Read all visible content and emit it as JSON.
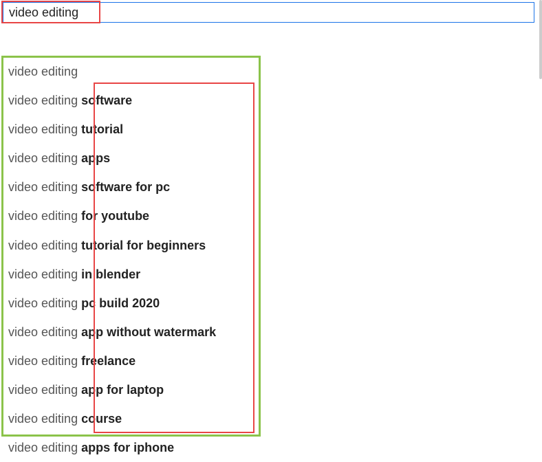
{
  "search": {
    "value": "video editing"
  },
  "suggestions": [
    {
      "prefix": "video editing",
      "completion": ""
    },
    {
      "prefix": "video editing ",
      "completion": "software"
    },
    {
      "prefix": "video editing ",
      "completion": "tutorial"
    },
    {
      "prefix": "video editing ",
      "completion": "apps"
    },
    {
      "prefix": "video editing ",
      "completion": "software for pc"
    },
    {
      "prefix": "video editing ",
      "completion": "for youtube"
    },
    {
      "prefix": "video editing ",
      "completion": "tutorial for beginners"
    },
    {
      "prefix": "video editing ",
      "completion": "in blender"
    },
    {
      "prefix": "video editing ",
      "completion": "pc build 2020"
    },
    {
      "prefix": "video editing ",
      "completion": "app without watermark"
    },
    {
      "prefix": "video editing ",
      "completion": "freelance"
    },
    {
      "prefix": "video editing ",
      "completion": "app for laptop"
    },
    {
      "prefix": "video editing ",
      "completion": "course"
    },
    {
      "prefix": "video editing ",
      "completion": "apps for iphone"
    }
  ]
}
